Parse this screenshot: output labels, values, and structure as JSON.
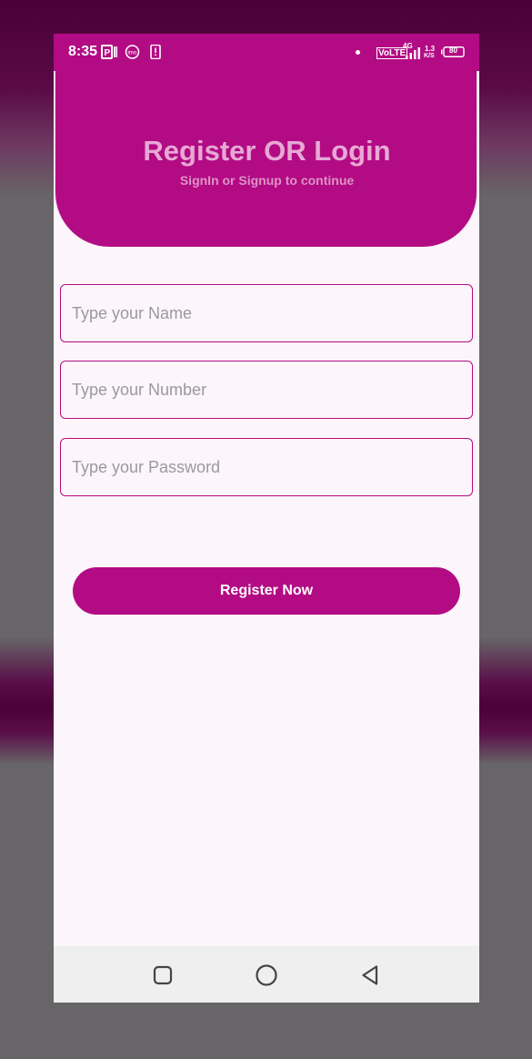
{
  "status_bar": {
    "time": "8:35",
    "network_label": "VoLTE",
    "network_gen": "4G",
    "speed_value": "1.3",
    "speed_unit": "K/S",
    "battery": "80"
  },
  "header": {
    "title": "Register OR Login",
    "subtitle": "SignIn or Signup to continue"
  },
  "form": {
    "name_placeholder": "Type your Name",
    "number_placeholder": "Type your Number",
    "password_placeholder": "Type your Password",
    "submit_label": "Register Now"
  },
  "nav_bar": {
    "icons": [
      "recent-apps-icon",
      "home-icon",
      "back-icon"
    ]
  },
  "colors": {
    "accent": "#b30b84",
    "title_text": "#e7a9d4",
    "background": "#fcf5fb"
  }
}
